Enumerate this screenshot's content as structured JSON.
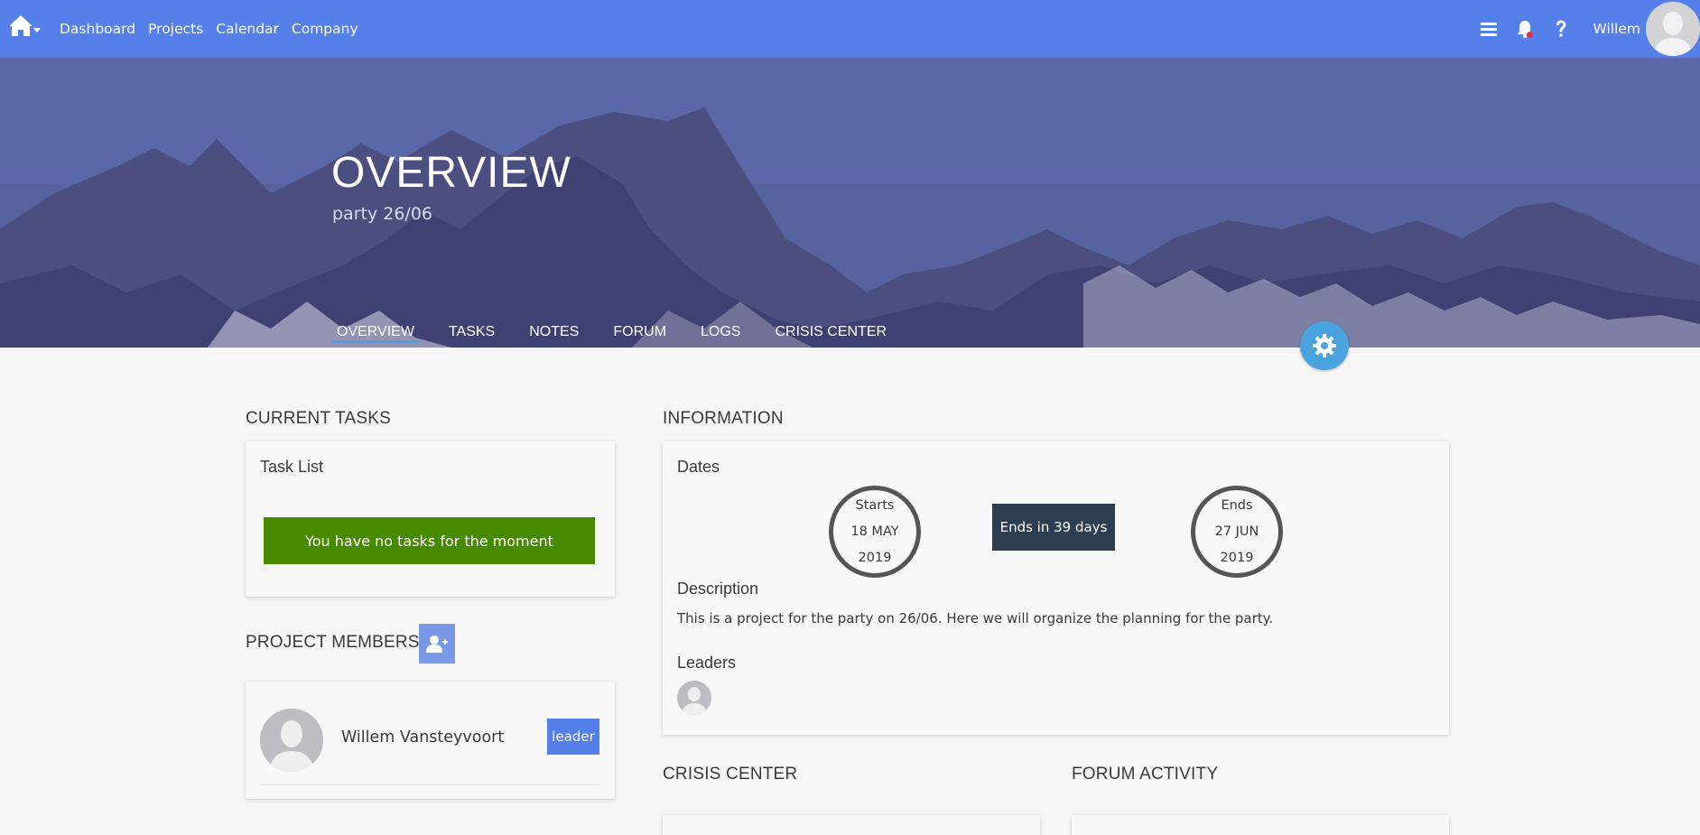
{
  "topnav": {
    "links": [
      "Dashboard",
      "Projects",
      "Calendar",
      "Company"
    ],
    "user_name": "Willem",
    "has_notification": true
  },
  "hero": {
    "title": "OVERVIEW",
    "subtitle": "party 26/06",
    "tabs": [
      "OVERVIEW",
      "TASKS",
      "NOTES",
      "FORUM",
      "LOGS",
      "CRISIS CENTER"
    ],
    "active_tab": "OVERVIEW"
  },
  "current_tasks": {
    "title": "CURRENT TASKS",
    "card_label": "Task List",
    "empty_message": "You have no tasks for the moment"
  },
  "project_members": {
    "title": "PROJECT MEMBERS",
    "members": [
      {
        "name": "Willem Vansteyvoort",
        "role": "leader"
      }
    ]
  },
  "information": {
    "title": "INFORMATION",
    "dates_label": "Dates",
    "start": {
      "label": "Starts",
      "day_month": "18 MAY",
      "year": "2019"
    },
    "countdown": "Ends in 39 days",
    "end": {
      "label": "Ends",
      "day_month": "27 JUN",
      "year": "2019"
    },
    "description_label": "Description",
    "description": "This is a project for the party on 26/06. Here we will organize the planning for the party.",
    "leaders_label": "Leaders"
  },
  "crisis_center": {
    "title": "CRISIS CENTER"
  },
  "forum_activity": {
    "title": "FORUM ACTIVITY"
  },
  "colors": {
    "nav": "#5680e9",
    "accent_blue": "#4aa3df",
    "success_green": "#478a00",
    "dark_badge": "#2c3e50"
  }
}
